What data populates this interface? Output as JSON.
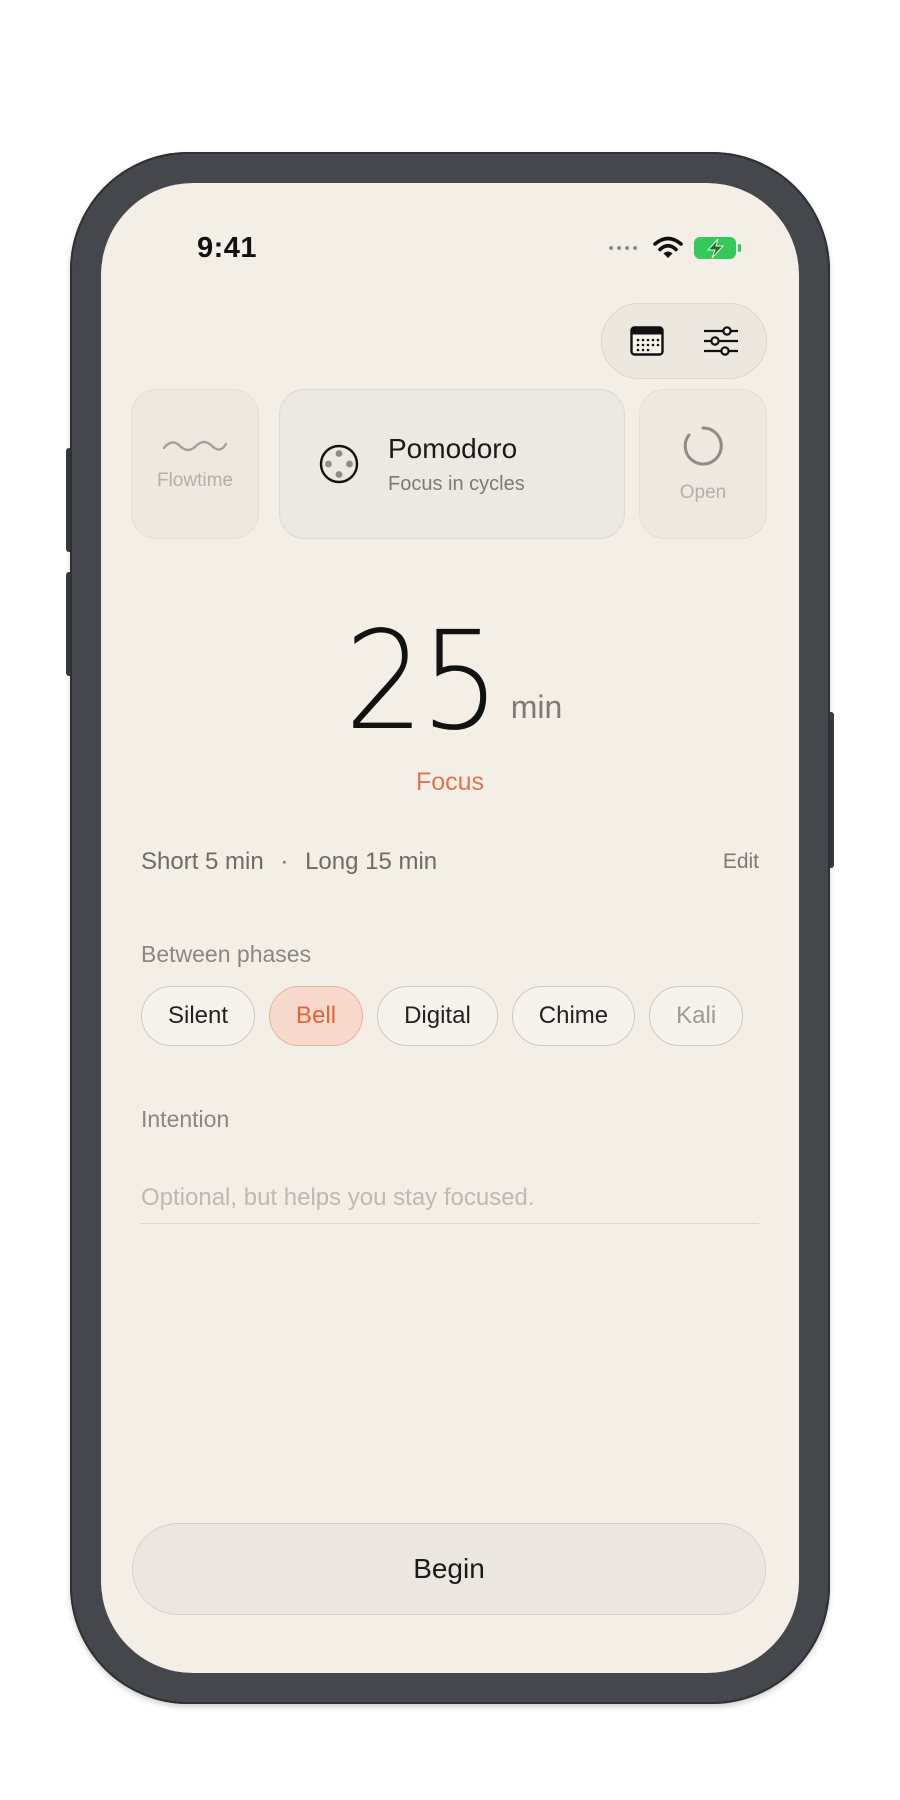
{
  "status_bar": {
    "time": "9:41",
    "icons": [
      "signal-dots-icon",
      "wifi-icon",
      "battery-charging-icon"
    ],
    "battery_color": "#34c759"
  },
  "top_actions": {
    "icons": [
      "calendar-icon",
      "sliders-icon"
    ]
  },
  "modes": {
    "left": {
      "icon": "wave-icon",
      "label": "Flowtime"
    },
    "current": {
      "icon": "pomodoro-icon",
      "title": "Pomodoro",
      "subtitle": "Focus in cycles"
    },
    "right": {
      "icon": "open-ring-icon",
      "label": "Open"
    }
  },
  "timer": {
    "value": "25",
    "unit": "min",
    "phase": "Focus",
    "accent": "#e0744f"
  },
  "breaks": {
    "short": "Short 5 min",
    "separator": "·",
    "long": "Long 15 min",
    "edit_label": "Edit"
  },
  "sound": {
    "label": "Between phases",
    "options": [
      "Silent",
      "Bell",
      "Digital",
      "Chime",
      "Kali"
    ],
    "selected": "Bell"
  },
  "intention": {
    "label": "Intention",
    "placeholder": "Optional, but helps you stay focused.",
    "value": ""
  },
  "begin_label": "Begin"
}
